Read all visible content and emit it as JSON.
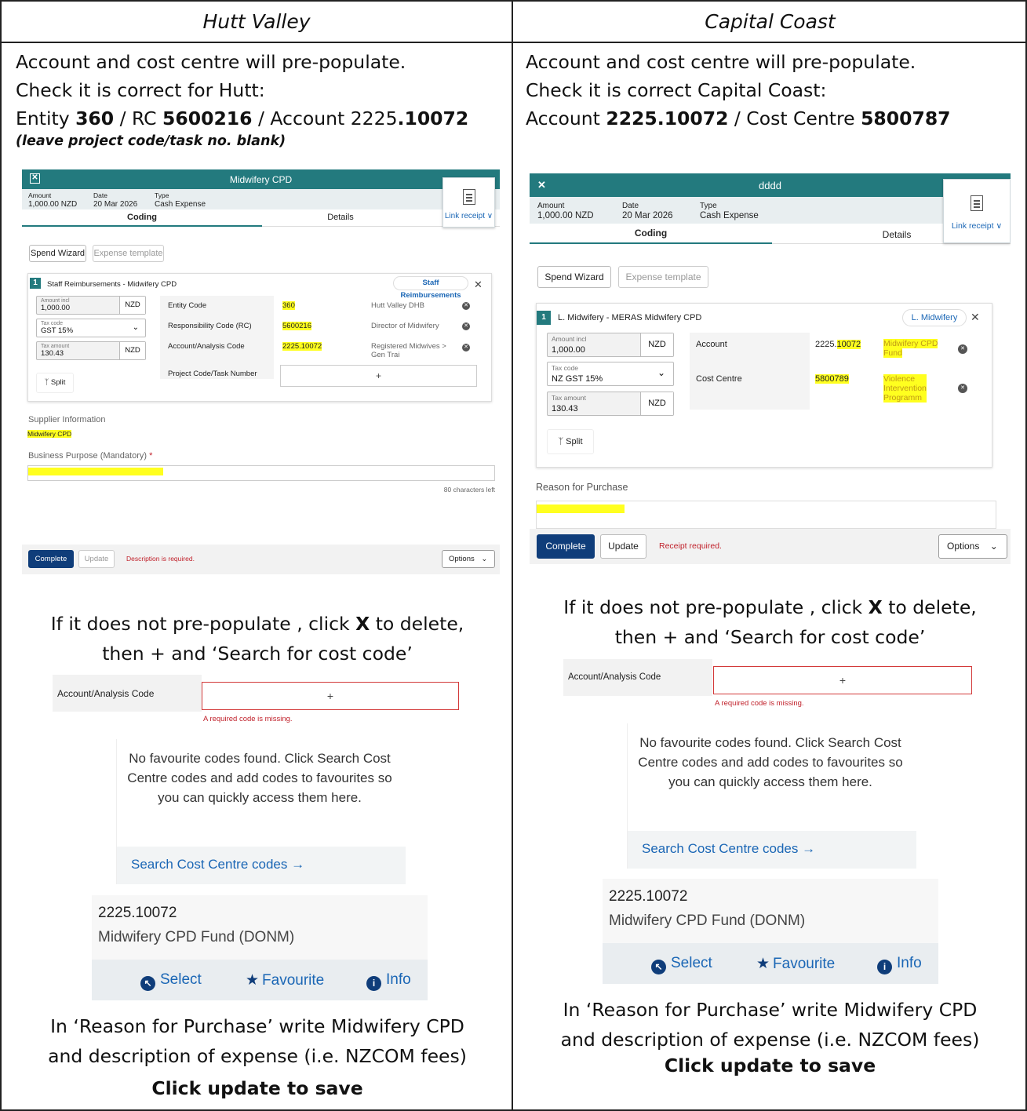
{
  "columns": {
    "left": {
      "header": "Hutt Valley",
      "intro": {
        "line1": "Account and cost centre will pre-populate.",
        "line2": "Check it is correct for Hutt:",
        "line3_a": "Entity ",
        "line3_b": "360",
        "line3_c": " / RC ",
        "line3_d": "5600216",
        "line3_e": " / Account 2225",
        "line3_f": ".10072"
      },
      "note": "(leave project code/task no. blank)",
      "screenshot": {
        "title": "Midwifery CPD",
        "amount_label": "Amount",
        "amount_value": "1,000.00 NZD",
        "date_label": "Date",
        "date_value": "20 Mar 2026",
        "type_label": "Type",
        "type_value": "Cash Expense",
        "tab_coding": "Coding",
        "tab_details": "Details",
        "link_receipt": "Link receipt ∨",
        "spend_wizard": "Spend Wizard",
        "expense_template": "Expense template",
        "line_number": "1",
        "line_title": "Staff Reimbursements  -  Midwifery CPD",
        "line_tag": "Staff Reimbursements",
        "close_x": "✕",
        "amount_incl_label": "Amount incl",
        "amount_incl_value": "1,000.00",
        "nzd": "NZD",
        "tax_code_label": "Tax code",
        "tax_code_value": "GST 15%",
        "tax_amount_label": "Tax amount",
        "tax_amount_value": "130.43",
        "split": "Split",
        "rows": [
          {
            "label": "Entity Code",
            "value": "360",
            "desc": "Hutt Valley DHB"
          },
          {
            "label": "Responsibility Code (RC)",
            "value": "5600216",
            "desc": "Director of Midwifery"
          },
          {
            "label": "Account/Analysis Code",
            "value": "2225.10072",
            "desc": "Registered Midwives > Gen Trai"
          },
          {
            "label": "Project Code/Task Number",
            "value": "+",
            "desc": ""
          }
        ],
        "supplier_label": "Supplier Information",
        "supplier_value": "Midwifery CPD",
        "purpose_label": "Business Purpose (Mandatory)",
        "required_star": "*",
        "chars_left": "80 characters left",
        "complete": "Complete",
        "update": "Update",
        "error": "Description is required.",
        "options": "Options"
      },
      "para1_a": "If it does not pre-populate , click ",
      "para1_b": "X",
      "para1_c": " to delete,",
      "para1_d": "then + and ‘Search for cost code’",
      "code_row_label": "Account/Analysis Code",
      "plus": "+",
      "missing": "A required code is missing.",
      "fav_text": "No favourite codes found. Click Search Cost Centre codes and add codes to favourites so you can quickly access them here.",
      "search_link": "Search Cost Centre codes →",
      "result_code": "2225.10072",
      "result_name": "Midwifery CPD Fund (DONM)",
      "select": "Select",
      "favourite": "Favourite",
      "info": "Info",
      "para2_line1": "In ‘Reason for Purchase’ write Midwifery CPD",
      "para2_line2": "and description of expense (i.e. NZCOM fees)",
      "save": "Click update to save"
    },
    "right": {
      "header": "Capital Coast",
      "intro": {
        "line1": "Account and cost centre will pre-populate.",
        "line2": "Check it is correct Capital Coast:",
        "line3_a": "Account ",
        "line3_b": "2225.10072",
        "line3_c": " / Cost Centre ",
        "line3_d": "5800787"
      },
      "screenshot": {
        "title": "dddd",
        "amount_label": "Amount",
        "amount_value": "1,000.00 NZD",
        "date_label": "Date",
        "date_value": "20 Mar 2026",
        "type_label": "Type",
        "type_value": "Cash Expense",
        "tab_coding": "Coding",
        "tab_details": "Details",
        "link_receipt": "Link receipt ∨",
        "spend_wizard": "Spend Wizard",
        "expense_template": "Expense template",
        "line_number": "1",
        "line_title": "L. Midwifery  -  MERAS Midwifery CPD",
        "line_tag": "L. Midwifery",
        "close_x": "✕",
        "amount_incl_label": "Amount incl",
        "amount_incl_value": "1,000.00",
        "nzd": "NZD",
        "tax_code_label": "Tax code",
        "tax_code_value": "NZ GST 15%",
        "tax_amount_label": "Tax amount",
        "tax_amount_value": "130.43",
        "split": "Split",
        "account_label": "Account",
        "account_value_a": "2225.",
        "account_value_b": "10072",
        "account_desc_1": "Midwifery CPD",
        "account_desc_2": "Fund",
        "cc_label": "Cost Centre",
        "cc_value": "5800789",
        "cc_desc_1": "Violence",
        "cc_desc_2": "Intervention",
        "cc_desc_3": "Programm",
        "reason_label": "Reason for Purchase",
        "complete": "Complete",
        "update": "Update",
        "error": "Receipt required.",
        "options": "Options"
      },
      "para1_a": "If it does not pre-populate , click ",
      "para1_b": "X",
      "para1_c": " to delete,",
      "para1_d": "then + and ‘Search for cost code’",
      "code_row_label": "Account/Analysis Code",
      "plus": "+",
      "missing": "A required code is missing.",
      "fav_text": "No favourite codes found. Click Search Cost Centre codes and add codes to favourites so you can quickly access them here.",
      "search_link": "Search Cost Centre codes →",
      "result_code": "2225.10072",
      "result_name": "Midwifery CPD Fund (DONM)",
      "select": "Select",
      "favourite": "Favourite",
      "info": "Info",
      "para2_line1": "In ‘Reason for Purchase’ write Midwifery CPD",
      "para2_line2": "and description of expense (i.e. NZCOM fees)",
      "save": "Click update to save"
    }
  },
  "colors": {
    "teal": "#237a7e",
    "primary": "#0f3d7a",
    "highlight": "#ffff1f",
    "error": "#c0202a",
    "link": "#1a66b5"
  }
}
